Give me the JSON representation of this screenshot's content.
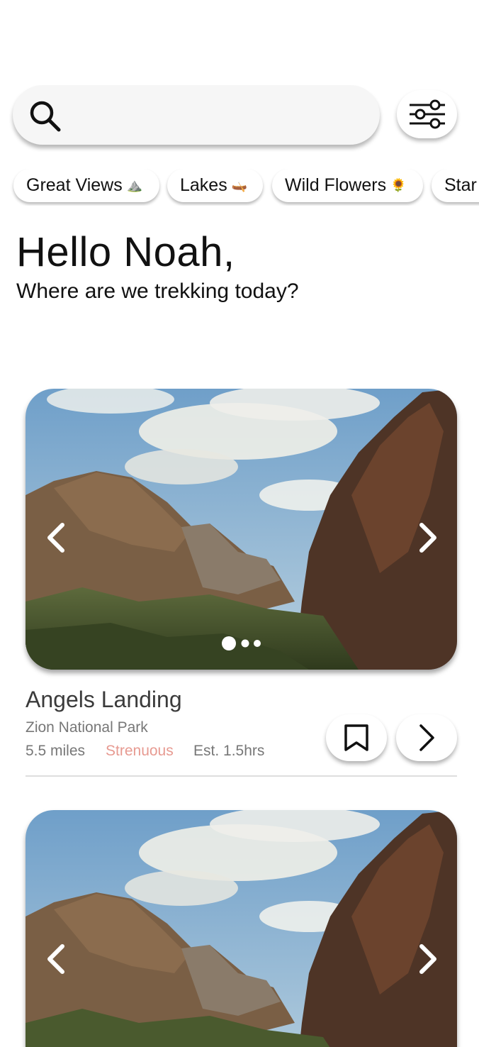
{
  "search": {
    "placeholder": ""
  },
  "chips": [
    {
      "label": "Great Views",
      "emoji": "⛰️"
    },
    {
      "label": "Lakes",
      "emoji": "🛶"
    },
    {
      "label": "Wild Flowers",
      "emoji": "🌻"
    },
    {
      "label": "Star",
      "emoji": ""
    }
  ],
  "greeting": {
    "title": "Hello Noah,",
    "subtitle": "Where are we trekking today?"
  },
  "trails": [
    {
      "name": "Angels Landing",
      "park": "Zion National Park",
      "distance": "5.5 miles",
      "difficulty": "Strenuous",
      "time": "Est. 1.5hrs",
      "image_count": 3,
      "active_image": 1
    }
  ],
  "colors": {
    "difficulty_strenuous": "#e79a91",
    "muted_text": "#777777",
    "background": "#ffffff"
  },
  "icons": {
    "search": "search-icon",
    "filter": "sliders-icon",
    "bookmark": "bookmark-icon",
    "next": "chevron-right-icon",
    "prev_image": "chevron-left-icon",
    "next_image": "chevron-right-icon"
  }
}
